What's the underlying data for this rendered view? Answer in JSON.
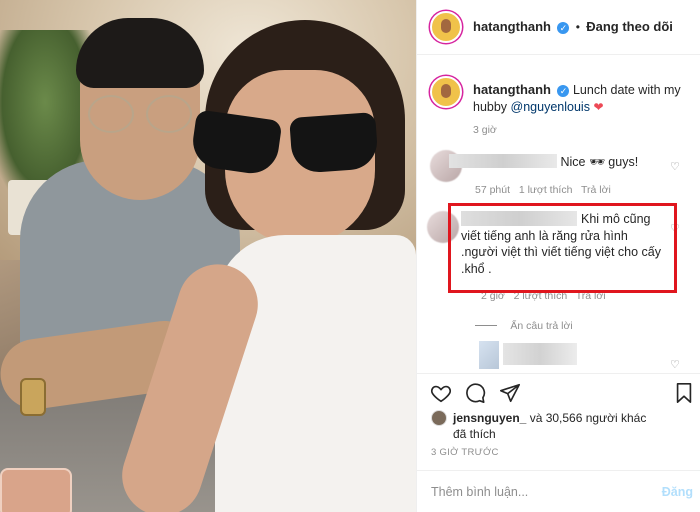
{
  "header": {
    "username": "hatangthanh",
    "separator": "•",
    "follow_label": "Đang theo dõi"
  },
  "caption": {
    "username": "hatangthanh",
    "text_before": "Lunch date with my hubby ",
    "mention": "@nguyenlouis",
    "emoji": "❤",
    "time": "3 giờ"
  },
  "comments": [
    {
      "text": "Nice 🕶 guys!",
      "time": "57 phút",
      "likes": "1 lượt thích",
      "reply": "Trả lời"
    },
    {
      "text": "Khi mô cũng viết tiếng anh là răng rửa hình .người việt thì viết tiếng việt cho cấy .khổ .",
      "time": "2 giờ",
      "likes": "2 lượt thích",
      "reply": "Trả lời",
      "hide_replies": "Ẩn câu trả lời"
    }
  ],
  "likes": {
    "user": "jensnguyen_",
    "rest": " và 30,566 người khác",
    "line2": "đã thích"
  },
  "time_ago": "3 GIỜ TRƯỚC",
  "comment_box": {
    "placeholder": "Thêm bình luận...",
    "post_label": "Đăng"
  },
  "colors": {
    "highlight_border": "#e0161e",
    "verified": "#3897f0",
    "heart": "#ed4956",
    "mention": "#00376b"
  },
  "icons": [
    "heart-icon",
    "comment-icon",
    "share-icon",
    "bookmark-icon",
    "verified-icon"
  ]
}
